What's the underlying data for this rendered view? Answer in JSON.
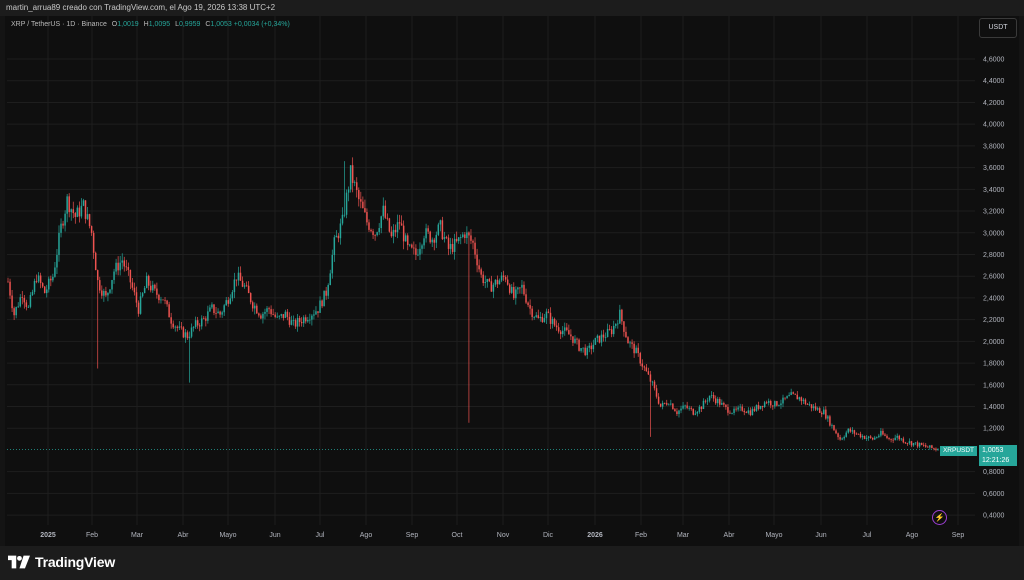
{
  "header": {
    "attribution": "martin_arrua89 creado con TradingView.com, el Ago 19, 2026 13:38 UTC+2"
  },
  "symbol": {
    "name": "XRP / TetherUS · 1D · Binance",
    "open_label": "O",
    "open": "1,0019",
    "high_label": "H",
    "high": "1,0095",
    "low_label": "L",
    "low": "0,9959",
    "close_label": "C",
    "close": "1,0053",
    "change": "+0,0034 (+0,34%)"
  },
  "currency_button": "USDT",
  "price_tag": {
    "symbol": "XRPUSDT",
    "price": "1,0053",
    "countdown": "12:21:26"
  },
  "footer": {
    "brand": "TradingView"
  },
  "colors": {
    "up": "#26a69a",
    "down": "#ef5350",
    "grid": "#1e1e1e",
    "text": "#b2b5be",
    "background": "#0f0f0f"
  },
  "chart_data": {
    "type": "candlestick",
    "title": "XRP / TetherUS · 1D · Binance",
    "y_ticks": [
      "4,6000",
      "4,4000",
      "4,2000",
      "4,0000",
      "3,8000",
      "3,6000",
      "3,4000",
      "3,2000",
      "3,0000",
      "2,8000",
      "2,6000",
      "2,4000",
      "2,2000",
      "2,0000",
      "1,8000",
      "1,6000",
      "1,4000",
      "1,2000",
      "0,8000",
      "0,6000",
      "0,4000"
    ],
    "x_ticks": [
      "2025",
      "Feb",
      "Mar",
      "Abr",
      "Mayo",
      "Jun",
      "Jul",
      "Ago",
      "Sep",
      "Oct",
      "Nov",
      "Dic",
      "2026",
      "Feb",
      "Mar",
      "Abr",
      "Mayo",
      "Jun",
      "Jul",
      "Ago",
      "Sep"
    ],
    "ylim": [
      0.3,
      4.8
    ],
    "last_price": 1.0053,
    "close_path": [
      [
        0,
        2.55
      ],
      [
        3,
        2.25
      ],
      [
        7,
        2.45
      ],
      [
        10,
        2.3
      ],
      [
        14,
        2.6
      ],
      [
        18,
        2.45
      ],
      [
        22,
        2.6
      ],
      [
        26,
        3.05
      ],
      [
        29,
        3.3
      ],
      [
        33,
        3.15
      ],
      [
        37,
        3.25
      ],
      [
        41,
        3.0
      ],
      [
        44,
        2.55
      ],
      [
        48,
        2.4
      ],
      [
        52,
        2.65
      ],
      [
        56,
        2.75
      ],
      [
        60,
        2.55
      ],
      [
        64,
        2.3
      ],
      [
        68,
        2.55
      ],
      [
        72,
        2.45
      ],
      [
        76,
        2.4
      ],
      [
        80,
        2.2
      ],
      [
        84,
        2.1
      ],
      [
        88,
        2.05
      ],
      [
        92,
        2.15
      ],
      [
        96,
        2.2
      ],
      [
        100,
        2.3
      ],
      [
        104,
        2.25
      ],
      [
        108,
        2.4
      ],
      [
        112,
        2.6
      ],
      [
        116,
        2.5
      ],
      [
        120,
        2.35
      ],
      [
        124,
        2.25
      ],
      [
        128,
        2.3
      ],
      [
        132,
        2.2
      ],
      [
        136,
        2.25
      ],
      [
        140,
        2.15
      ],
      [
        144,
        2.2
      ],
      [
        148,
        2.25
      ],
      [
        152,
        2.3
      ],
      [
        156,
        2.45
      ],
      [
        160,
        2.9
      ],
      [
        164,
        3.1
      ],
      [
        168,
        3.55
      ],
      [
        172,
        3.3
      ],
      [
        176,
        3.1
      ],
      [
        180,
        3.0
      ],
      [
        184,
        3.2
      ],
      [
        188,
        2.95
      ],
      [
        192,
        3.1
      ],
      [
        196,
        2.85
      ],
      [
        200,
        2.8
      ],
      [
        204,
        3.0
      ],
      [
        208,
        2.95
      ],
      [
        212,
        3.05
      ],
      [
        216,
        2.85
      ],
      [
        220,
        2.9
      ],
      [
        224,
        3.0
      ],
      [
        228,
        2.9
      ],
      [
        232,
        2.6
      ],
      [
        236,
        2.5
      ],
      [
        240,
        2.55
      ],
      [
        244,
        2.6
      ],
      [
        248,
        2.4
      ],
      [
        252,
        2.5
      ],
      [
        256,
        2.3
      ],
      [
        260,
        2.2
      ],
      [
        264,
        2.25
      ],
      [
        268,
        2.15
      ],
      [
        272,
        2.1
      ],
      [
        276,
        2.05
      ],
      [
        280,
        1.95
      ],
      [
        284,
        1.9
      ],
      [
        288,
        2.0
      ],
      [
        292,
        2.05
      ],
      [
        296,
        2.1
      ],
      [
        300,
        2.25
      ],
      [
        304,
        2.0
      ],
      [
        308,
        1.9
      ],
      [
        312,
        1.75
      ],
      [
        316,
        1.6
      ],
      [
        320,
        1.4
      ],
      [
        324,
        1.45
      ],
      [
        328,
        1.35
      ],
      [
        332,
        1.4
      ],
      [
        336,
        1.35
      ],
      [
        340,
        1.4
      ],
      [
        344,
        1.5
      ],
      [
        348,
        1.45
      ],
      [
        352,
        1.38
      ],
      [
        356,
        1.35
      ],
      [
        360,
        1.38
      ],
      [
        364,
        1.35
      ],
      [
        368,
        1.4
      ],
      [
        372,
        1.45
      ],
      [
        376,
        1.42
      ],
      [
        380,
        1.45
      ],
      [
        384,
        1.5
      ],
      [
        388,
        1.48
      ],
      [
        392,
        1.42
      ],
      [
        396,
        1.38
      ],
      [
        400,
        1.35
      ],
      [
        404,
        1.22
      ],
      [
        408,
        1.1
      ],
      [
        412,
        1.18
      ],
      [
        416,
        1.15
      ],
      [
        420,
        1.12
      ],
      [
        424,
        1.1
      ],
      [
        428,
        1.15
      ],
      [
        432,
        1.1
      ],
      [
        436,
        1.12
      ],
      [
        440,
        1.08
      ],
      [
        444,
        1.06
      ],
      [
        448,
        1.04
      ],
      [
        452,
        1.02
      ],
      [
        456,
        1.0053
      ]
    ],
    "notable_wicks": [
      {
        "day": 44,
        "low": 1.75
      },
      {
        "day": 89,
        "low": 1.62
      },
      {
        "day": 165,
        "high": 3.66
      },
      {
        "day": 226,
        "low": 1.25
      },
      {
        "day": 315,
        "low": 1.12
      }
    ]
  }
}
